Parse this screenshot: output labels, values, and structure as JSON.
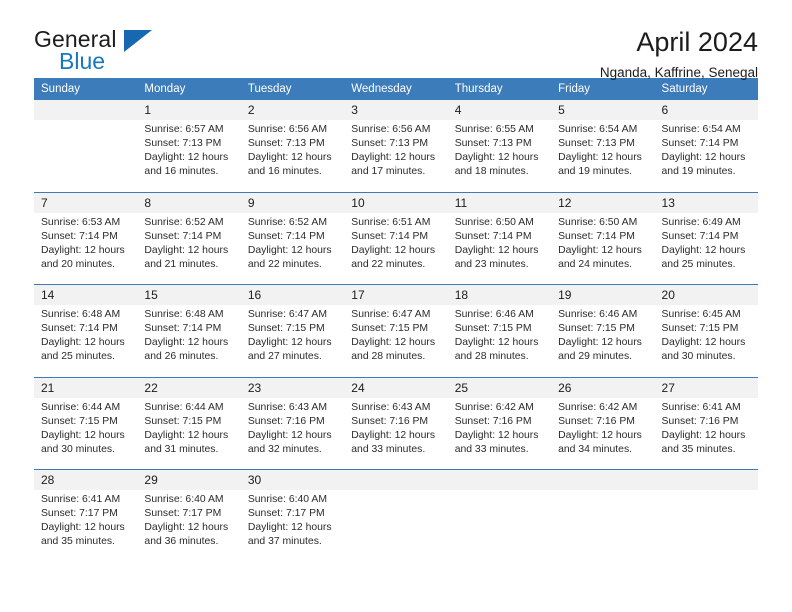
{
  "brand": {
    "name_top": "General",
    "name_bottom": "Blue",
    "triangle_color": "#1668b0"
  },
  "header": {
    "title": "April 2024",
    "subtitle": "Nganda, Kaffrine, Senegal",
    "accent_color": "#3c7cba"
  },
  "calendar": {
    "weekday_headers": [
      "Sunday",
      "Monday",
      "Tuesday",
      "Wednesday",
      "Thursday",
      "Friday",
      "Saturday"
    ],
    "weeks": [
      {
        "days": [
          {
            "number": "",
            "sunrise": "",
            "sunset": "",
            "daylight_line1": "",
            "daylight_line2": ""
          },
          {
            "number": "1",
            "sunrise": "Sunrise: 6:57 AM",
            "sunset": "Sunset: 7:13 PM",
            "daylight_line1": "Daylight: 12 hours",
            "daylight_line2": "and 16 minutes."
          },
          {
            "number": "2",
            "sunrise": "Sunrise: 6:56 AM",
            "sunset": "Sunset: 7:13 PM",
            "daylight_line1": "Daylight: 12 hours",
            "daylight_line2": "and 16 minutes."
          },
          {
            "number": "3",
            "sunrise": "Sunrise: 6:56 AM",
            "sunset": "Sunset: 7:13 PM",
            "daylight_line1": "Daylight: 12 hours",
            "daylight_line2": "and 17 minutes."
          },
          {
            "number": "4",
            "sunrise": "Sunrise: 6:55 AM",
            "sunset": "Sunset: 7:13 PM",
            "daylight_line1": "Daylight: 12 hours",
            "daylight_line2": "and 18 minutes."
          },
          {
            "number": "5",
            "sunrise": "Sunrise: 6:54 AM",
            "sunset": "Sunset: 7:13 PM",
            "daylight_line1": "Daylight: 12 hours",
            "daylight_line2": "and 19 minutes."
          },
          {
            "number": "6",
            "sunrise": "Sunrise: 6:54 AM",
            "sunset": "Sunset: 7:14 PM",
            "daylight_line1": "Daylight: 12 hours",
            "daylight_line2": "and 19 minutes."
          }
        ]
      },
      {
        "days": [
          {
            "number": "7",
            "sunrise": "Sunrise: 6:53 AM",
            "sunset": "Sunset: 7:14 PM",
            "daylight_line1": "Daylight: 12 hours",
            "daylight_line2": "and 20 minutes."
          },
          {
            "number": "8",
            "sunrise": "Sunrise: 6:52 AM",
            "sunset": "Sunset: 7:14 PM",
            "daylight_line1": "Daylight: 12 hours",
            "daylight_line2": "and 21 minutes."
          },
          {
            "number": "9",
            "sunrise": "Sunrise: 6:52 AM",
            "sunset": "Sunset: 7:14 PM",
            "daylight_line1": "Daylight: 12 hours",
            "daylight_line2": "and 22 minutes."
          },
          {
            "number": "10",
            "sunrise": "Sunrise: 6:51 AM",
            "sunset": "Sunset: 7:14 PM",
            "daylight_line1": "Daylight: 12 hours",
            "daylight_line2": "and 22 minutes."
          },
          {
            "number": "11",
            "sunrise": "Sunrise: 6:50 AM",
            "sunset": "Sunset: 7:14 PM",
            "daylight_line1": "Daylight: 12 hours",
            "daylight_line2": "and 23 minutes."
          },
          {
            "number": "12",
            "sunrise": "Sunrise: 6:50 AM",
            "sunset": "Sunset: 7:14 PM",
            "daylight_line1": "Daylight: 12 hours",
            "daylight_line2": "and 24 minutes."
          },
          {
            "number": "13",
            "sunrise": "Sunrise: 6:49 AM",
            "sunset": "Sunset: 7:14 PM",
            "daylight_line1": "Daylight: 12 hours",
            "daylight_line2": "and 25 minutes."
          }
        ]
      },
      {
        "days": [
          {
            "number": "14",
            "sunrise": "Sunrise: 6:48 AM",
            "sunset": "Sunset: 7:14 PM",
            "daylight_line1": "Daylight: 12 hours",
            "daylight_line2": "and 25 minutes."
          },
          {
            "number": "15",
            "sunrise": "Sunrise: 6:48 AM",
            "sunset": "Sunset: 7:14 PM",
            "daylight_line1": "Daylight: 12 hours",
            "daylight_line2": "and 26 minutes."
          },
          {
            "number": "16",
            "sunrise": "Sunrise: 6:47 AM",
            "sunset": "Sunset: 7:15 PM",
            "daylight_line1": "Daylight: 12 hours",
            "daylight_line2": "and 27 minutes."
          },
          {
            "number": "17",
            "sunrise": "Sunrise: 6:47 AM",
            "sunset": "Sunset: 7:15 PM",
            "daylight_line1": "Daylight: 12 hours",
            "daylight_line2": "and 28 minutes."
          },
          {
            "number": "18",
            "sunrise": "Sunrise: 6:46 AM",
            "sunset": "Sunset: 7:15 PM",
            "daylight_line1": "Daylight: 12 hours",
            "daylight_line2": "and 28 minutes."
          },
          {
            "number": "19",
            "sunrise": "Sunrise: 6:46 AM",
            "sunset": "Sunset: 7:15 PM",
            "daylight_line1": "Daylight: 12 hours",
            "daylight_line2": "and 29 minutes."
          },
          {
            "number": "20",
            "sunrise": "Sunrise: 6:45 AM",
            "sunset": "Sunset: 7:15 PM",
            "daylight_line1": "Daylight: 12 hours",
            "daylight_line2": "and 30 minutes."
          }
        ]
      },
      {
        "days": [
          {
            "number": "21",
            "sunrise": "Sunrise: 6:44 AM",
            "sunset": "Sunset: 7:15 PM",
            "daylight_line1": "Daylight: 12 hours",
            "daylight_line2": "and 30 minutes."
          },
          {
            "number": "22",
            "sunrise": "Sunrise: 6:44 AM",
            "sunset": "Sunset: 7:15 PM",
            "daylight_line1": "Daylight: 12 hours",
            "daylight_line2": "and 31 minutes."
          },
          {
            "number": "23",
            "sunrise": "Sunrise: 6:43 AM",
            "sunset": "Sunset: 7:16 PM",
            "daylight_line1": "Daylight: 12 hours",
            "daylight_line2": "and 32 minutes."
          },
          {
            "number": "24",
            "sunrise": "Sunrise: 6:43 AM",
            "sunset": "Sunset: 7:16 PM",
            "daylight_line1": "Daylight: 12 hours",
            "daylight_line2": "and 33 minutes."
          },
          {
            "number": "25",
            "sunrise": "Sunrise: 6:42 AM",
            "sunset": "Sunset: 7:16 PM",
            "daylight_line1": "Daylight: 12 hours",
            "daylight_line2": "and 33 minutes."
          },
          {
            "number": "26",
            "sunrise": "Sunrise: 6:42 AM",
            "sunset": "Sunset: 7:16 PM",
            "daylight_line1": "Daylight: 12 hours",
            "daylight_line2": "and 34 minutes."
          },
          {
            "number": "27",
            "sunrise": "Sunrise: 6:41 AM",
            "sunset": "Sunset: 7:16 PM",
            "daylight_line1": "Daylight: 12 hours",
            "daylight_line2": "and 35 minutes."
          }
        ]
      },
      {
        "days": [
          {
            "number": "28",
            "sunrise": "Sunrise: 6:41 AM",
            "sunset": "Sunset: 7:17 PM",
            "daylight_line1": "Daylight: 12 hours",
            "daylight_line2": "and 35 minutes."
          },
          {
            "number": "29",
            "sunrise": "Sunrise: 6:40 AM",
            "sunset": "Sunset: 7:17 PM",
            "daylight_line1": "Daylight: 12 hours",
            "daylight_line2": "and 36 minutes."
          },
          {
            "number": "30",
            "sunrise": "Sunrise: 6:40 AM",
            "sunset": "Sunset: 7:17 PM",
            "daylight_line1": "Daylight: 12 hours",
            "daylight_line2": "and 37 minutes."
          },
          {
            "number": "",
            "sunrise": "",
            "sunset": "",
            "daylight_line1": "",
            "daylight_line2": ""
          },
          {
            "number": "",
            "sunrise": "",
            "sunset": "",
            "daylight_line1": "",
            "daylight_line2": ""
          },
          {
            "number": "",
            "sunrise": "",
            "sunset": "",
            "daylight_line1": "",
            "daylight_line2": ""
          },
          {
            "number": "",
            "sunrise": "",
            "sunset": "",
            "daylight_line1": "",
            "daylight_line2": ""
          }
        ]
      }
    ]
  }
}
